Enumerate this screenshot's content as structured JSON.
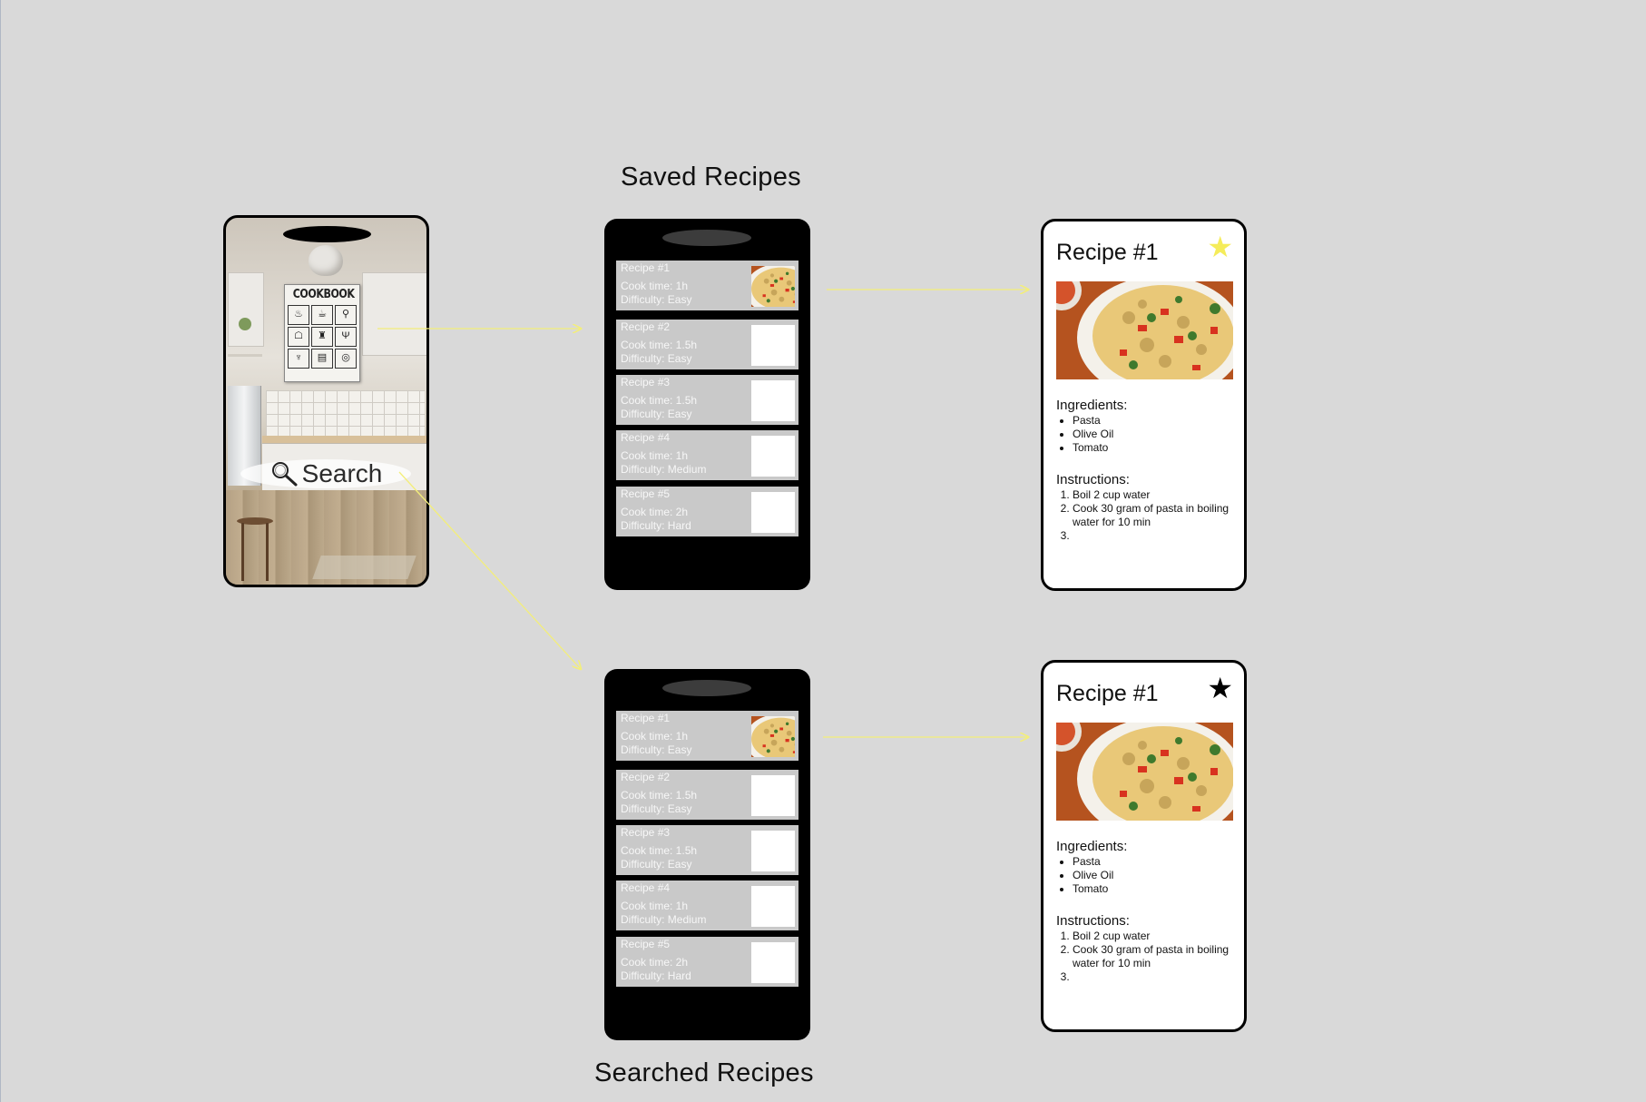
{
  "titles": {
    "saved": "Saved Recipes",
    "searched": "Searched Recipes"
  },
  "home": {
    "cookbook_title": "COOKBOOK",
    "search_label": "Search",
    "search_icon": "magnifier-icon"
  },
  "saved_list": {
    "recipes": [
      {
        "name": "Recipe #1",
        "cook_time": "Cook time: 1h",
        "difficulty": "Difficulty: Easy",
        "has_image": true
      },
      {
        "name": "Recipe #2",
        "cook_time": "Cook time: 1.5h",
        "difficulty": "Difficulty: Easy",
        "has_image": false
      },
      {
        "name": "Recipe #3",
        "cook_time": "Cook time: 1.5h",
        "difficulty": "Difficulty: Easy",
        "has_image": false
      },
      {
        "name": "Recipe #4",
        "cook_time": "Cook time: 1h",
        "difficulty": "Difficulty: Medium",
        "has_image": false
      },
      {
        "name": "Recipe #5",
        "cook_time": "Cook time: 2h",
        "difficulty": "Difficulty: Hard",
        "has_image": false
      }
    ]
  },
  "searched_list": {
    "recipes": [
      {
        "name": "Recipe #1",
        "cook_time": "Cook time: 1h",
        "difficulty": "Difficulty: Easy",
        "has_image": true
      },
      {
        "name": "Recipe #2",
        "cook_time": "Cook time: 1.5h",
        "difficulty": "Difficulty: Easy",
        "has_image": false
      },
      {
        "name": "Recipe #3",
        "cook_time": "Cook time: 1.5h",
        "difficulty": "Difficulty: Easy",
        "has_image": false
      },
      {
        "name": "Recipe #4",
        "cook_time": "Cook time: 1h",
        "difficulty": "Difficulty: Medium",
        "has_image": false
      },
      {
        "name": "Recipe #5",
        "cook_time": "Cook time: 2h",
        "difficulty": "Difficulty: Hard",
        "has_image": false
      }
    ]
  },
  "detail_saved": {
    "title": "Recipe #1",
    "star": "★",
    "star_color": "#f5ec5a",
    "ingredients_heading": "Ingredients:",
    "ingredients": [
      "Pasta",
      "Olive Oil",
      "Tomato"
    ],
    "instructions_heading": "Instructions:",
    "instructions": [
      "Boil 2 cup water",
      "Cook 30 gram of pasta in boiling water for 10 min",
      ""
    ]
  },
  "detail_searched": {
    "title": "Recipe #1",
    "star": "★",
    "star_color": "#000000",
    "ingredients_heading": "Ingredients:",
    "ingredients": [
      "Pasta",
      "Olive Oil",
      "Tomato"
    ],
    "instructions_heading": "Instructions:",
    "instructions": [
      "Boil 2 cup water",
      "Cook 30 gram of pasta in boiling water for 10 min",
      ""
    ]
  },
  "colors": {
    "canvas": "#d9d9d9",
    "arrow": "#f3ee7a",
    "row_bg": "#c9c9c9"
  }
}
